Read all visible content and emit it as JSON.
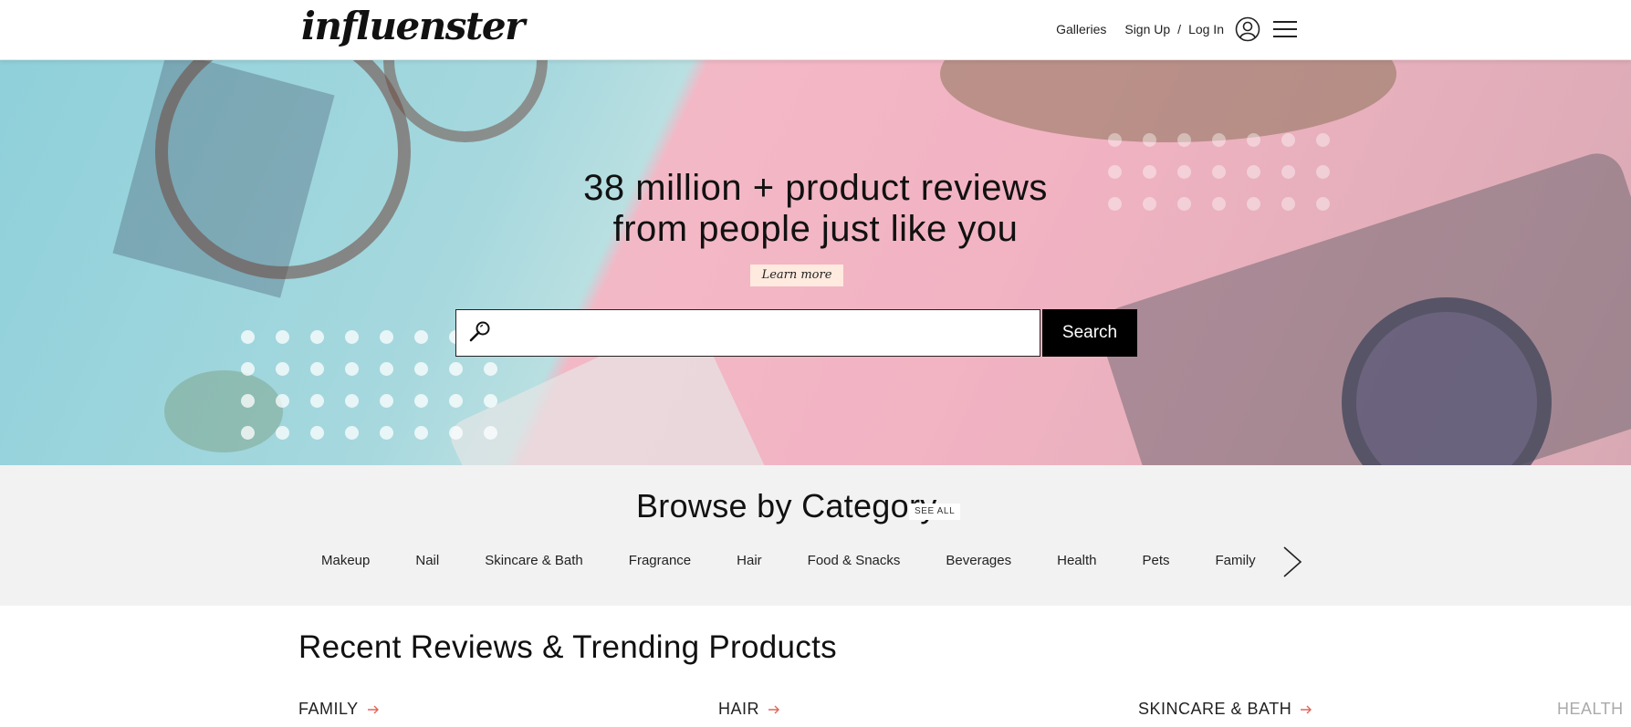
{
  "header": {
    "logo": "influenster",
    "nav": {
      "galleries": "Galleries",
      "sign_up": "Sign Up",
      "separator": "/",
      "log_in": "Log In"
    },
    "icons": [
      "user-icon",
      "hamburger-menu-icon"
    ]
  },
  "hero": {
    "headline_line1": "38 million + product reviews",
    "headline_line2": "from people just like you",
    "learn_more": "Learn more",
    "search": {
      "placeholder": "",
      "value": "",
      "button_label": "Search",
      "icon": "search-icon"
    }
  },
  "browse": {
    "title": "Browse by Category",
    "see_all": "SEE ALL",
    "categories": [
      "Makeup",
      "Nail",
      "Skincare & Bath",
      "Fragrance",
      "Hair",
      "Food & Snacks",
      "Beverages",
      "Health",
      "Pets",
      "Family"
    ],
    "next_icon": "chevron-right-icon"
  },
  "recent": {
    "title": "Recent Reviews & Trending Products",
    "columns": [
      "FAMILY",
      "HAIR",
      "SKINCARE & BATH",
      "HEALTH"
    ]
  },
  "colors": {
    "accent_arrow": "#e0675a",
    "button_bg": "#000000",
    "browse_bg": "#f2f2f2"
  }
}
